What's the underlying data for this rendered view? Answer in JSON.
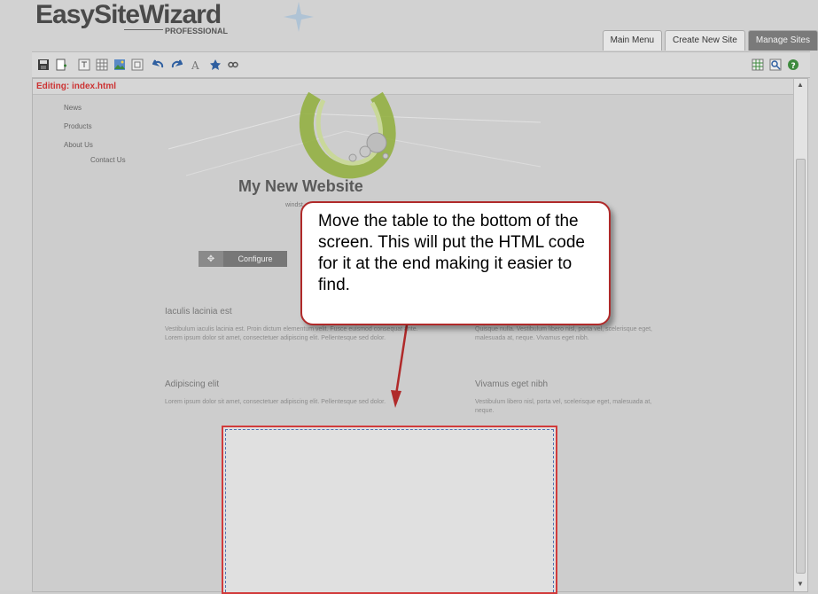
{
  "app": {
    "logo_text": "EasySiteWizard",
    "logo_sub": "PROFESSIONAL"
  },
  "tabs": [
    {
      "label": "Main Menu"
    },
    {
      "label": "Create New Site"
    },
    {
      "label": "Manage Sites"
    }
  ],
  "toolbar": {
    "left_icons": [
      "save-icon",
      "new-page-icon",
      "text-box-icon",
      "table-icon",
      "image-icon",
      "frame-icon",
      "undo-icon",
      "redo-icon",
      "font-icon",
      "favorite-icon",
      "link-icon"
    ],
    "right_icons": [
      "grid-icon",
      "preview-icon",
      "help-icon"
    ]
  },
  "editor": {
    "title": "Editing: index.html"
  },
  "page": {
    "nav": [
      "News",
      "Products",
      "About Us",
      "Contact Us"
    ],
    "site_title": "My New Website",
    "site_subtitle": "windst...",
    "configure_label": "Configure",
    "columns": [
      {
        "heading": "Iaculis lacinia est",
        "text": "Vestibulum iaculis lacinia est. Proin dictum elementum velit. Fusce euismod consequat ante. Lorem ipsum dolor sit amet, consectetuer adipiscing elit. Pellentesque sed dolor."
      },
      {
        "heading": "",
        "text": "Quisque nulla. Vestibulum libero nisl, porta vel, scelerisque eget, malesuada at, neque. Vivamus eget nibh."
      },
      {
        "heading": "Adipiscing elit",
        "text": "Lorem ipsum dolor sit amet, consectetuer adipiscing elit. Pellentesque sed dolor."
      },
      {
        "heading": "Vivamus eget nibh",
        "text": "Vestibulum libero nisl, porta vel, scelerisque eget, malesuada at, neque."
      }
    ]
  },
  "callout": {
    "text": "Move the table to the bottom of the screen.  This will put the HTML code for it at the end making it easier to find."
  },
  "colors": {
    "accent_red": "#b02a2a",
    "table_outline": "#d23a3a",
    "dashed_blue": "#4d6fb0"
  }
}
